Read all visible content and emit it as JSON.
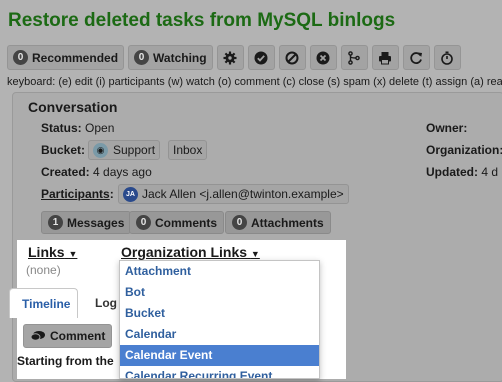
{
  "title": "Restore deleted tasks from MySQL binlogs",
  "toolbar": {
    "recommended_count": "0",
    "recommended_label": "Recommended",
    "watching_count": "0",
    "watching_label": "Watching",
    "icons": [
      "gear-icon",
      "check-icon",
      "ban-icon",
      "close-icon",
      "merge-icon",
      "print-icon",
      "refresh-icon",
      "timer-icon"
    ]
  },
  "keyboard_hint": "keyboard: (e) edit (i) participants (w) watch (o) comment (c) close (s) spam (x) delete (t) assign (a) reac",
  "conversation": {
    "heading": "Conversation",
    "status_label": "Status:",
    "status_value": "Open",
    "bucket_label": "Bucket:",
    "bucket_support": "Support",
    "bucket_inbox": "Inbox",
    "created_label": "Created:",
    "created_value": "4 days ago",
    "participants_label": "Participants",
    "participant": "Jack Allen <j.allen@twinton.example>",
    "participant_initials": "JA",
    "owner_label": "Owner:",
    "organization_label": "Organization:",
    "updated_label": "Updated:",
    "updated_value": "4 d"
  },
  "counters": {
    "messages_count": "1",
    "messages_label": "Messages",
    "comments_count": "0",
    "comments_label": "Comments",
    "attachments_count": "0",
    "attachments_label": "Attachments"
  },
  "links": {
    "links_label": "Links",
    "org_links_label": "Organization Links",
    "none_text": "(none)"
  },
  "dropdown": {
    "items": [
      "Attachment",
      "Bot",
      "Bucket",
      "Calendar",
      "Calendar Event",
      "Calendar Recurring Event"
    ],
    "selected": "Calendar Event"
  },
  "tabs": {
    "timeline": "Timeline",
    "log": "Log"
  },
  "comment_button": "Comment",
  "starting_text": "Starting from the"
}
